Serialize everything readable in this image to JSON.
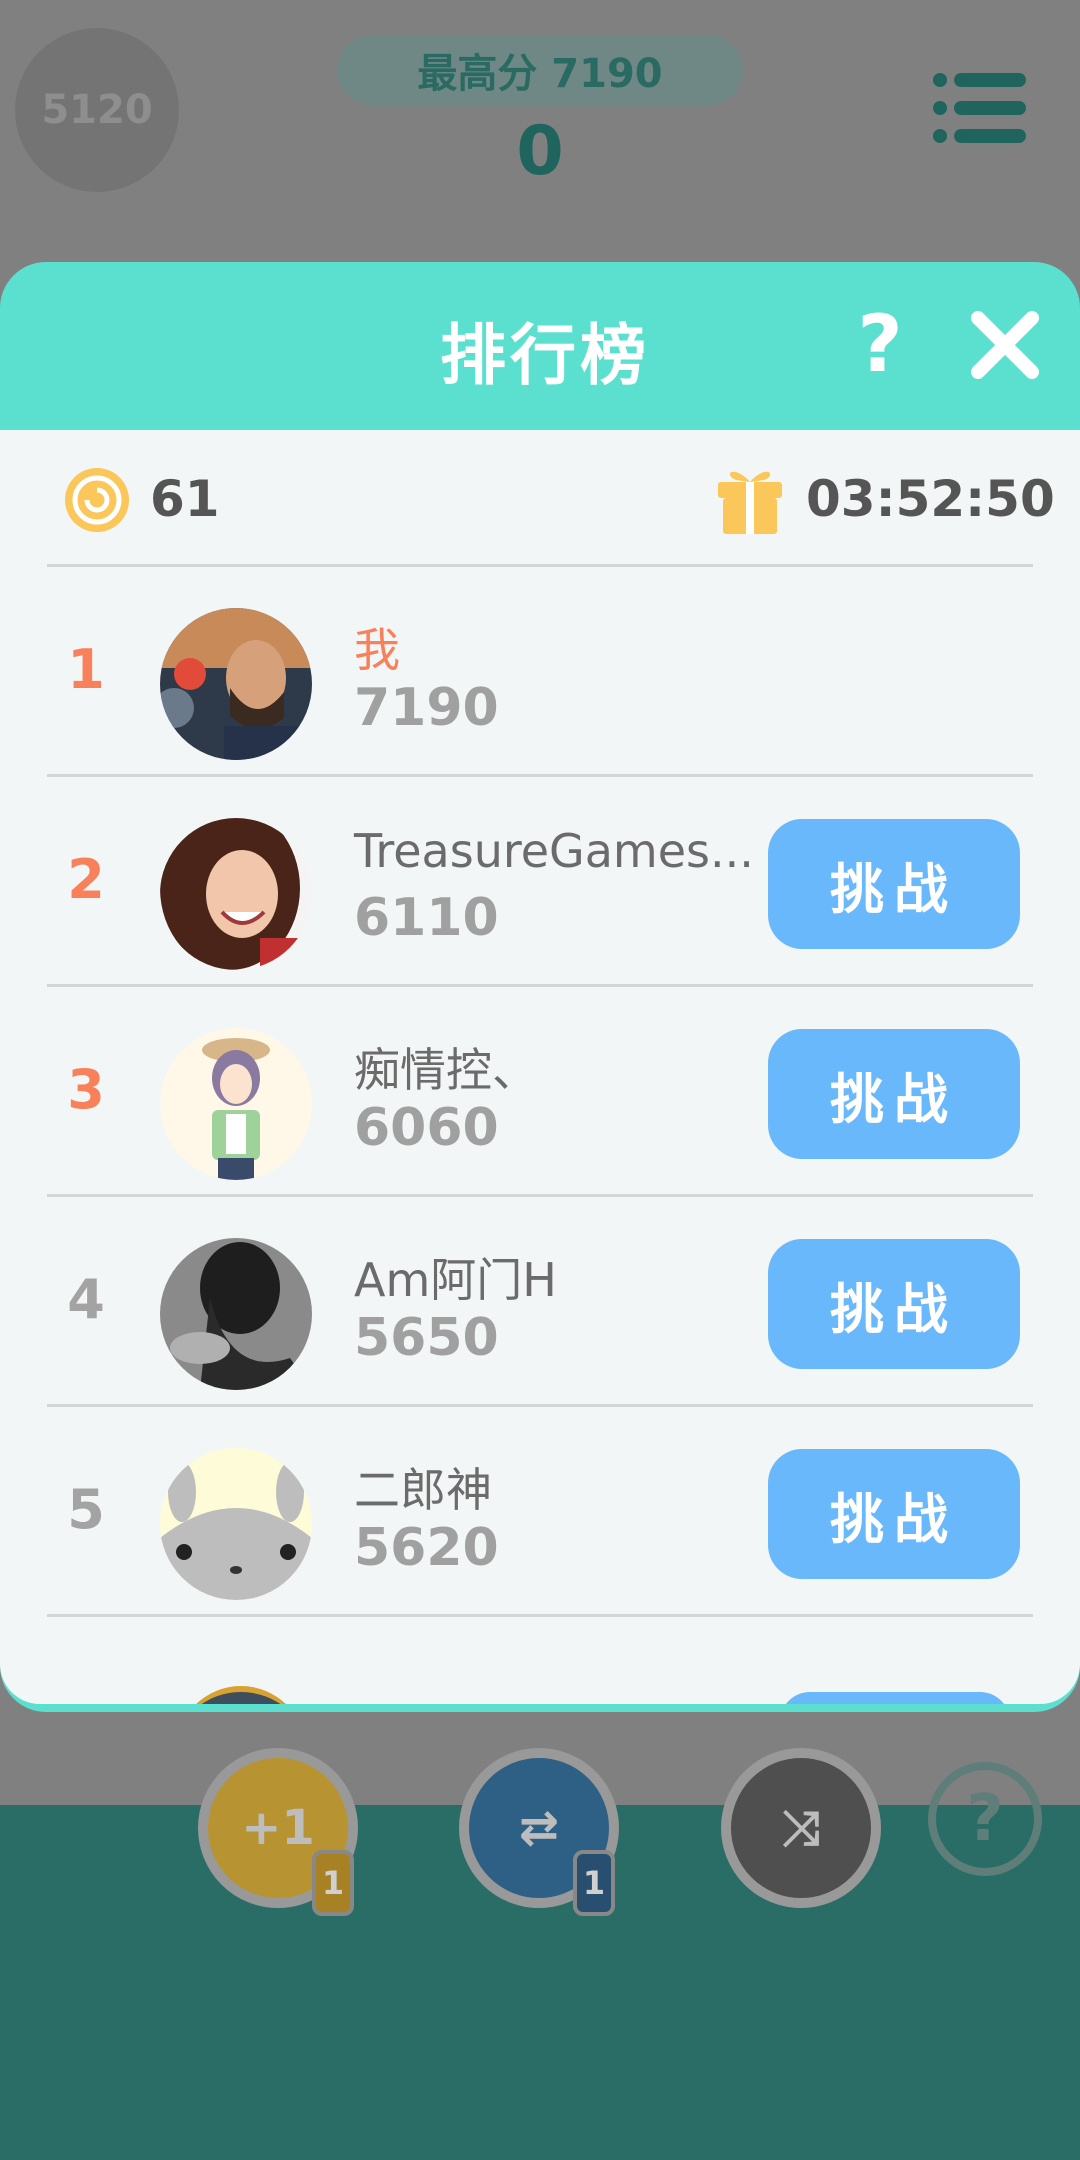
{
  "game": {
    "score_badge": "5120",
    "best_label": "最高分 7190",
    "current_score": "0",
    "menu_icon": "menu-icon",
    "boosters": [
      {
        "name": "plus-one",
        "label": "+1",
        "count": "1",
        "color": "#b89331"
      },
      {
        "name": "swap",
        "label": "⇄",
        "count": "1",
        "color": "#2e5f84"
      },
      {
        "name": "shuffle",
        "label": "⤨",
        "count": "",
        "color": "#4f4f4f"
      },
      {
        "name": "help",
        "label": "?",
        "count": ""
      }
    ]
  },
  "modal": {
    "title": "排行榜",
    "help_label": "?",
    "close_icon": "close-icon",
    "coins": "61",
    "coin_icon": "coin-icon",
    "gift_icon": "gift-icon",
    "timer": "03:52:50",
    "accent_color": "#5bdfcf",
    "rank_color": "#f8815c",
    "button_color": "#6ab8fc"
  },
  "leaderboard": [
    {
      "rank": "1",
      "name": "我",
      "score": "7190",
      "is_me": true
    },
    {
      "rank": "2",
      "name": "TreasureGames...",
      "score": "6110",
      "button": "挑战"
    },
    {
      "rank": "3",
      "name": "痴情控、",
      "score": "6060",
      "button": "挑战"
    },
    {
      "rank": "4",
      "name": "Am阿门H",
      "score": "5650",
      "button": "挑战"
    },
    {
      "rank": "5",
      "name": "二郎神",
      "score": "5620",
      "button": "挑战"
    }
  ]
}
